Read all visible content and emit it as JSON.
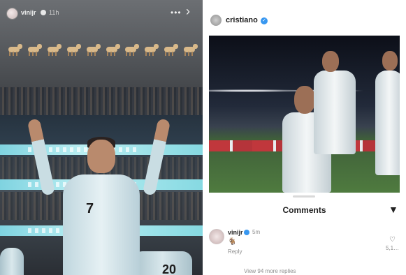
{
  "story": {
    "username": "vinijr",
    "time": "11h",
    "more_icon": "more-dots-icon",
    "close_icon": "close-icon",
    "sticker_icon": "goat-emoji-icon",
    "jersey_number_main": "7",
    "jersey_number_back": "20"
  },
  "post": {
    "username": "cristiano",
    "verified_icon": "verified-badge-icon",
    "comments_title": "Comments",
    "filter_icon": "filter-icon",
    "comment": {
      "username": "vinijr",
      "time": "5m",
      "text": "🐐",
      "reply_label": "Reply",
      "like_count": "5,1…"
    },
    "view_replies": "View 94 more replies"
  },
  "colors": {
    "verified": "#3897f0",
    "story_bg": "#2a2c30",
    "sheet_bg": "#ffffff"
  }
}
